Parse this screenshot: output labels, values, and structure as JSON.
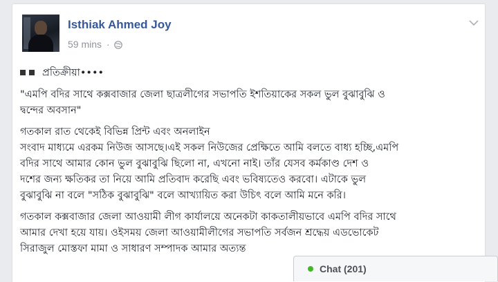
{
  "post": {
    "author": "Isthiak Ahmed Joy",
    "time": "59 mins",
    "separator": "·",
    "icons": [
      "globe-icon",
      "chevron-down-icon",
      "avatar"
    ],
    "reaction_line": "প্রতিক্রীয়া••••",
    "quote_line1": "\"এমপি বদির সাথে কক্সবাজার জেলা ছাত্রলীগের সভাপতি ইশতিয়াকের সকল ভুল বুঝাবুঝি ও",
    "quote_line2": "দ্বন্দের অবসান\"",
    "para2_line1": "গতকাল রাত থেকেই বিভিন্ন প্রিন্ট এবং অনলাইন",
    "para2_line2": "সংবাদ মাধ্যমে এরকম নিউজ আসছে।এই সকল নিউজের প্রেক্ষিতে আমি বলতে বাধ্য হচ্ছি,এমপি",
    "para2_line3": "বদির সাথে আমার কোন ভুল বুঝাবুঝি ছিলো না, এখনো নাই। তাঁর যেসব কর্মকাণ্ড দেশ ও",
    "para2_line4": "দশের জন্য ক্ষতিকর তা নিয়ে আমি প্রতিবাদ করেছি এবং ভবিষ্যতেও করবো। এটাকে ভুল",
    "para2_line5": "বুঝাবুঝি না বলে \"সঠিক বুঝাবুঝি\" বলে আখ্যায়িত করা উচিৎ বলে আমি মনে করি।",
    "para3_line1": "গতকাল কক্সবাজার জেলা আওয়ামী লীগ কার্যালয়ে অনেকটা কাকতালীয়ভাবে এমপি বদির সাথে",
    "para3_line2": "আমার দেখা হয়ে যায়। ওইসময় জেলা আওয়ামীলীগের সভাপতি সর্বজন শ্রদ্ধেয় এডভোকেট",
    "para3_line3": "সিরাজুল মোস্তফা মামা ও সাধারণ সম্পাদক আমার অত্যন্ত"
  },
  "chat": {
    "label": "Chat (201)",
    "status_color": "#42b72a"
  },
  "colors": {
    "author_link": "#365899",
    "page_background": "#e9ebee"
  }
}
